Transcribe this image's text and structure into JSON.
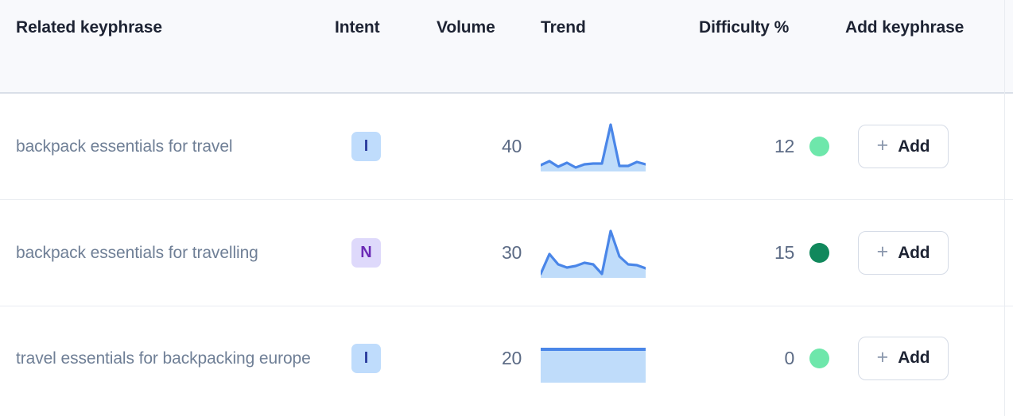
{
  "table": {
    "columns": [
      {
        "key": "keyphrase",
        "label": "Related keyphrase"
      },
      {
        "key": "intent",
        "label": "Intent"
      },
      {
        "key": "volume",
        "label": "Volume"
      },
      {
        "key": "trend",
        "label": "Trend"
      },
      {
        "key": "difficulty",
        "label": "Difficulty %"
      },
      {
        "key": "add",
        "label": "Add keyphrase"
      }
    ],
    "rows": [
      {
        "keyphrase": "backpack essentials for travel",
        "intent": "I",
        "intent_style": "intent-I",
        "volume": "40",
        "difficulty": "12",
        "difficulty_color": "#6ee7ab",
        "add_label": "Add",
        "add_icon": "+"
      },
      {
        "keyphrase": "backpack essentials for travelling",
        "intent": "N",
        "intent_style": "intent-N",
        "volume": "30",
        "difficulty": "15",
        "difficulty_color": "#11885c",
        "add_label": "Add",
        "add_icon": "+"
      },
      {
        "keyphrase": "travel essentials for backpacking europe",
        "intent": "I",
        "intent_style": "intent-I",
        "volume": "20",
        "difficulty": "0",
        "difficulty_color": "#6ee7ab",
        "add_label": "Add",
        "add_icon": "+"
      }
    ]
  },
  "chart_data": [
    {
      "type": "area",
      "title": "Trend sparkline - backpack essentials for travel",
      "line_color": "#4a86e8",
      "fill_color": "#bfdcfa",
      "x": [
        0,
        1,
        2,
        3,
        4,
        5,
        6,
        7,
        8,
        9,
        10,
        11,
        12
      ],
      "values": [
        12,
        20,
        9,
        17,
        8,
        14,
        15,
        15,
        96,
        10,
        11,
        18,
        13
      ],
      "ylim": [
        0,
        100
      ],
      "grid": false,
      "xlabel": "",
      "ylabel": ""
    },
    {
      "type": "area",
      "title": "Trend sparkline - backpack essentials for travelling",
      "line_color": "#4a86e8",
      "fill_color": "#bfdcfa",
      "x": [
        0,
        1,
        2,
        3,
        4,
        5,
        6,
        7,
        8,
        9,
        10,
        11,
        12
      ],
      "values": [
        8,
        42,
        22,
        16,
        20,
        26,
        22,
        8,
        96,
        38,
        22,
        20,
        14
      ],
      "ylim": [
        0,
        100
      ],
      "grid": false,
      "xlabel": "",
      "ylabel": ""
    },
    {
      "type": "area",
      "title": "Trend sparkline - travel essentials for backpacking europe",
      "line_color": "#4a86e8",
      "fill_color": "#bfdcfa",
      "x": [
        0,
        1,
        2,
        3,
        4,
        5,
        6,
        7,
        8,
        9,
        10,
        11,
        12
      ],
      "values": [
        40,
        40,
        40,
        40,
        40,
        40,
        40,
        40,
        40,
        40,
        40,
        40,
        40
      ],
      "ylim": [
        0,
        100
      ],
      "grid": false,
      "xlabel": "",
      "ylabel": ""
    }
  ]
}
